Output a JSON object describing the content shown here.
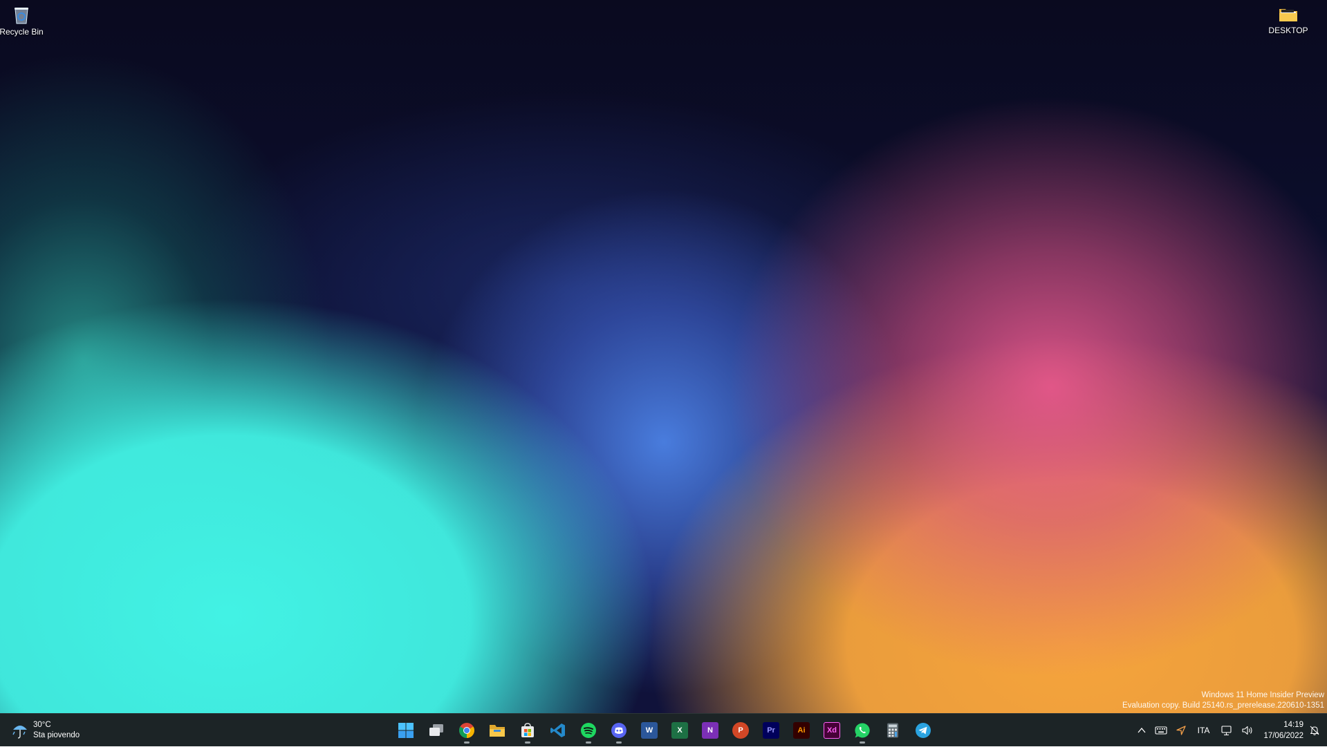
{
  "desktop": {
    "icons": [
      {
        "label": "Recycle Bin",
        "icon": "recycle-bin-icon"
      },
      {
        "label": "DESKTOP",
        "icon": "folder-icon"
      }
    ],
    "watermark": {
      "line1": "Windows 11 Home Insider Preview",
      "line2": "Evaluation copy. Build 25140.rs_prerelease.220610-1351"
    }
  },
  "taskbar": {
    "weather": {
      "temp": "30°C",
      "condition": "Sta piovendo",
      "icon": "umbrella-rain-icon"
    },
    "apps": [
      {
        "name": "start",
        "icon": "windows-start-icon",
        "running": false
      },
      {
        "name": "task-view",
        "icon": "task-view-icon",
        "running": false
      },
      {
        "name": "chrome",
        "icon": "chrome-icon",
        "running": true
      },
      {
        "name": "file-explorer",
        "icon": "file-explorer-icon",
        "running": false
      },
      {
        "name": "microsoft-store",
        "icon": "store-icon",
        "running": true
      },
      {
        "name": "vscode",
        "icon": "vscode-icon",
        "running": false
      },
      {
        "name": "spotify",
        "icon": "spotify-icon",
        "running": true
      },
      {
        "name": "discord",
        "icon": "discord-icon",
        "running": true
      },
      {
        "name": "word",
        "icon": "word-icon",
        "running": false,
        "letter": "W"
      },
      {
        "name": "excel",
        "icon": "excel-icon",
        "running": false,
        "letter": "X"
      },
      {
        "name": "onenote",
        "icon": "onenote-icon",
        "running": false,
        "letter": "N"
      },
      {
        "name": "powerpoint",
        "icon": "powerpoint-icon",
        "running": false,
        "letter": "P"
      },
      {
        "name": "premiere",
        "icon": "premiere-icon",
        "running": false,
        "letter": "Pr"
      },
      {
        "name": "illustrator",
        "icon": "illustrator-icon",
        "running": false,
        "letter": "Ai"
      },
      {
        "name": "adobe-xd",
        "icon": "xd-icon",
        "running": false,
        "letter": "Xd"
      },
      {
        "name": "whatsapp",
        "icon": "whatsapp-icon",
        "running": true
      },
      {
        "name": "calculator",
        "icon": "calculator-icon",
        "running": false
      },
      {
        "name": "telegram",
        "icon": "telegram-icon",
        "running": false
      }
    ],
    "tray": {
      "language": "ITA",
      "time": "14:19",
      "date": "17/06/2022"
    }
  },
  "colors": {
    "taskbar_bg": "#1c2426",
    "word": "#2b579a",
    "excel": "#1d7044",
    "onenote": "#7b2fb6",
    "powerpoint": "#d24726",
    "premiere": "#00005b",
    "illustrator": "#330000",
    "xd": "#470137",
    "spotify": "#1ed760",
    "discord": "#5865f2",
    "whatsapp": "#25d366",
    "telegram": "#2aa3e0",
    "vscode": "#2489ca"
  }
}
